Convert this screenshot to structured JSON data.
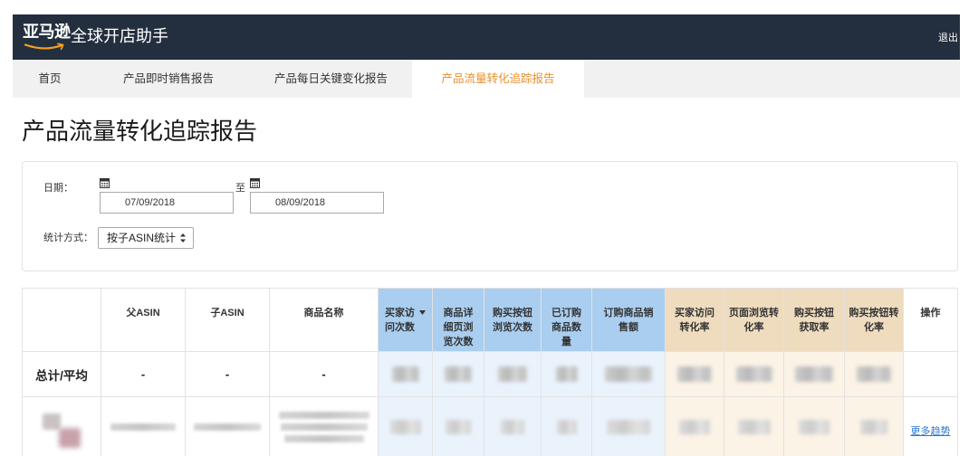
{
  "header": {
    "logo_text": "亚马逊",
    "app_title": "全球开店助手",
    "logout_label": "退出"
  },
  "nav": {
    "tabs": [
      {
        "label": "首页",
        "active": false
      },
      {
        "label": "产品即时销售报告",
        "active": false
      },
      {
        "label": "产品每日关键变化报告",
        "active": false
      },
      {
        "label": "产品流量转化追踪报告",
        "active": true
      }
    ]
  },
  "page": {
    "title": "产品流量转化追踪报告"
  },
  "filters": {
    "date": {
      "label": "日期：",
      "start": "07/09/2018",
      "separator": "至",
      "end": "08/09/2018"
    },
    "stat_method": {
      "label": "统计方式：",
      "value": "按子ASIN统计"
    }
  },
  "table": {
    "columns": [
      {
        "label": "父ASIN"
      },
      {
        "label": "子ASIN"
      },
      {
        "label": "商品名称"
      },
      {
        "label": "买家访问次数",
        "sorted": true
      },
      {
        "label": "商品详细页浏览次数"
      },
      {
        "label": "购买按钮浏览次数"
      },
      {
        "label": "已订购商品数量"
      },
      {
        "label": "订购商品销售额"
      },
      {
        "label": "买家访问转化率"
      },
      {
        "label": "页面浏览转化率"
      },
      {
        "label": "购买按钮获取率"
      },
      {
        "label": "购买按钮转化率"
      },
      {
        "label": "操作"
      }
    ],
    "total_row": {
      "label": "总计/平均",
      "parent_asin": "-",
      "child_asin": "-",
      "product_name": "-"
    },
    "rows": [
      {
        "action_label": "更多趋势"
      }
    ]
  },
  "colors": {
    "header_bg": "#232f3e",
    "accent": "#e8912d",
    "logo_smile": "#f4a01d",
    "traffic_header": "#aacef0",
    "traffic_cell": "#eaf3fc",
    "conversion_header": "#efdcbf",
    "conversion_cell": "#fbf3e6",
    "link": "#2a78cf"
  },
  "icons": {
    "logo_smile": "amazon-smile-icon",
    "date_picker": "calendar-icon",
    "sort": "sort-desc-icon",
    "select": "select-arrows-icon"
  }
}
